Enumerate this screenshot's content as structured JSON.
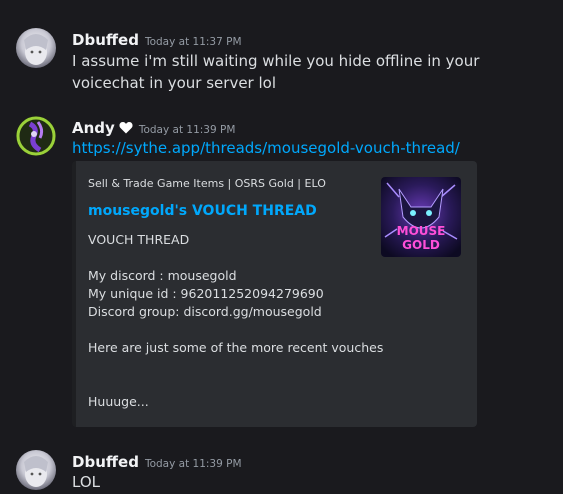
{
  "messages": [
    {
      "username": "Dbuffed",
      "timestamp": "Today at 11:37 PM",
      "text": "I assume i'm still waiting while you hide offline in your voicechat in your server lol"
    },
    {
      "username": "Andy",
      "timestamp": "Today at 11:39 PM",
      "link": "https://sythe.app/threads/mousegold-vouch-thread/",
      "embed": {
        "provider": "Sell & Trade Game Items | OSRS Gold | ELO",
        "title": "mousegold's VOUCH THREAD",
        "thumbnail_text": "MOUSE GOLD",
        "description_lines": [
          "VOUCH THREAD",
          "",
          "My discord : mousegold",
          "My unique id : 962011252094279690",
          "Discord group: discord.gg/mousegold",
          "",
          "Here are just some of the more recent vouches",
          "",
          "",
          "Huuuge..."
        ]
      }
    },
    {
      "username": "Dbuffed",
      "timestamp": "Today at 11:39 PM",
      "text": "LOL"
    }
  ],
  "colors": {
    "background": "#1a1a1e",
    "link": "#00a8fc",
    "embed_bg": "#2b2d31",
    "username": "#f2f3f5",
    "timestamp": "#949ba4"
  },
  "icons": {
    "dbuffed_avatar": "avatar-icon",
    "andy_avatar": "avatar-icon",
    "andy_badge": "heart-icon"
  }
}
